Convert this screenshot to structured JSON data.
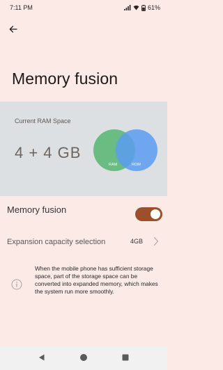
{
  "status": {
    "time": "7:11 PM",
    "battery": "61%",
    "icons": [
      "signal-icon",
      "wifi-icon",
      "battery-icon"
    ]
  },
  "header": {
    "back_icon": "arrow-left-icon",
    "title": "Memory fusion"
  },
  "ram_card": {
    "label": "Current RAM Space",
    "value": "4 + 4 GB",
    "venn": {
      "left_label": "RAM",
      "right_label": "ROM",
      "left_color": "#5fb87a",
      "right_color": "#5b9cf2"
    }
  },
  "fusion": {
    "label": "Memory fusion",
    "enabled": true,
    "accent": "#9b4f2a"
  },
  "capacity": {
    "label": "Expansion capacity selection",
    "value": "4GB"
  },
  "info": {
    "icon": "info-icon",
    "text": "When the mobile phone has sufficient storage space, part of the storage space can be converted into expanded memory, which makes the system run more smoothly."
  },
  "nav": {
    "buttons": [
      "back-triangle-icon",
      "home-circle-icon",
      "recents-square-icon"
    ]
  }
}
